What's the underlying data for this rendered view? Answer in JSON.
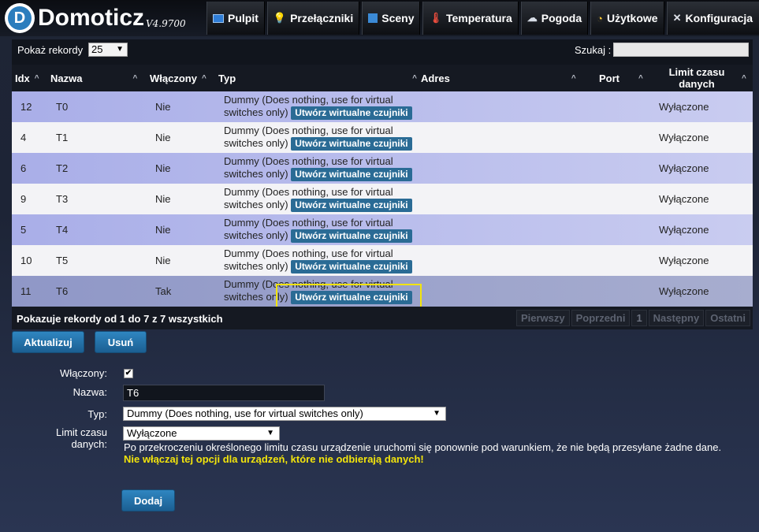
{
  "header": {
    "logo_letter": "D",
    "app_name": "Domoticz",
    "version": "V4.9700",
    "nav": [
      {
        "label": "Pulpit",
        "icon": "dashboard-icon"
      },
      {
        "label": "Przełączniki",
        "icon": "lightbulb-icon"
      },
      {
        "label": "Sceny",
        "icon": "scenes-icon"
      },
      {
        "label": "Temperatura",
        "icon": "thermometer-icon"
      },
      {
        "label": "Pogoda",
        "icon": "weather-cloud-icon"
      },
      {
        "label": "Użytkowe",
        "icon": "utility-icon"
      },
      {
        "label": "Konfiguracja",
        "icon": "wrench-icon"
      }
    ]
  },
  "table": {
    "show_label": "Pokaż rekordy",
    "page_size": "25",
    "search_label": "Szukaj :",
    "search_value": "",
    "columns": {
      "idx": "Idx",
      "name": "Nazwa",
      "enabled": "Włączony",
      "type": "Typ",
      "address": "Adres",
      "port": "Port",
      "data_timeout": "Limit czasu danych"
    },
    "rows": [
      {
        "idx": "12",
        "name": "T0",
        "enabled": "Nie",
        "type": "Dummy (Does nothing, use for virtual switches only)",
        "button": "Utwórz wirtualne czujniki",
        "address": "",
        "port": "",
        "data_timeout": "Wyłączone"
      },
      {
        "idx": "4",
        "name": "T1",
        "enabled": "Nie",
        "type": "Dummy (Does nothing, use for virtual switches only)",
        "button": "Utwórz wirtualne czujniki",
        "address": "",
        "port": "",
        "data_timeout": "Wyłączone"
      },
      {
        "idx": "6",
        "name": "T2",
        "enabled": "Nie",
        "type": "Dummy (Does nothing, use for virtual switches only)",
        "button": "Utwórz wirtualne czujniki",
        "address": "",
        "port": "",
        "data_timeout": "Wyłączone"
      },
      {
        "idx": "9",
        "name": "T3",
        "enabled": "Nie",
        "type": "Dummy (Does nothing, use for virtual switches only)",
        "button": "Utwórz wirtualne czujniki",
        "address": "",
        "port": "",
        "data_timeout": "Wyłączone"
      },
      {
        "idx": "5",
        "name": "T4",
        "enabled": "Nie",
        "type": "Dummy (Does nothing, use for virtual switches only)",
        "button": "Utwórz wirtualne czujniki",
        "address": "",
        "port": "",
        "data_timeout": "Wyłączone"
      },
      {
        "idx": "10",
        "name": "T5",
        "enabled": "Nie",
        "type": "Dummy (Does nothing, use for virtual switches only)",
        "button": "Utwórz wirtualne czujniki",
        "address": "",
        "port": "",
        "data_timeout": "Wyłączone"
      },
      {
        "idx": "11",
        "name": "T6",
        "enabled": "Tak",
        "type": "Dummy (Does nothing, use for virtual switches only)",
        "button": "Utwórz wirtualne czujniki",
        "address": "",
        "port": "",
        "data_timeout": "Wyłączone"
      }
    ],
    "info": "Pokazuje rekordy od 1 do 7 z 7 wszystkich",
    "pager": {
      "first": "Pierwszy",
      "prev": "Poprzedni",
      "current": "1",
      "next": "Następny",
      "last": "Ostatni"
    }
  },
  "actions": {
    "update": "Aktualizuj",
    "delete": "Usuń"
  },
  "form": {
    "enabled_label": "Włączony:",
    "enabled_checked": "✔",
    "name_label": "Nazwa:",
    "name_value": "T6",
    "type_label": "Typ:",
    "type_value": "Dummy (Does nothing, use for virtual switches only)",
    "timeout_label": "Limit czasu danych:",
    "timeout_value": "Wyłączone",
    "timeout_note": "Po przekroczeniu określonego limitu czasu urządzenie uruchomi się ponownie pod warunkiem, że nie będą przesyłane żadne dane.",
    "timeout_warning": "Nie włączaj tej opcji dla urządzeń, które nie odbierają danych!",
    "add_button": "Dodaj"
  },
  "colors": {
    "accent_blue": "#2f86c1",
    "highlight_yellow": "#f2e40c",
    "row_odd": "#c9ccf0",
    "row_selected": "#a7adcf"
  }
}
